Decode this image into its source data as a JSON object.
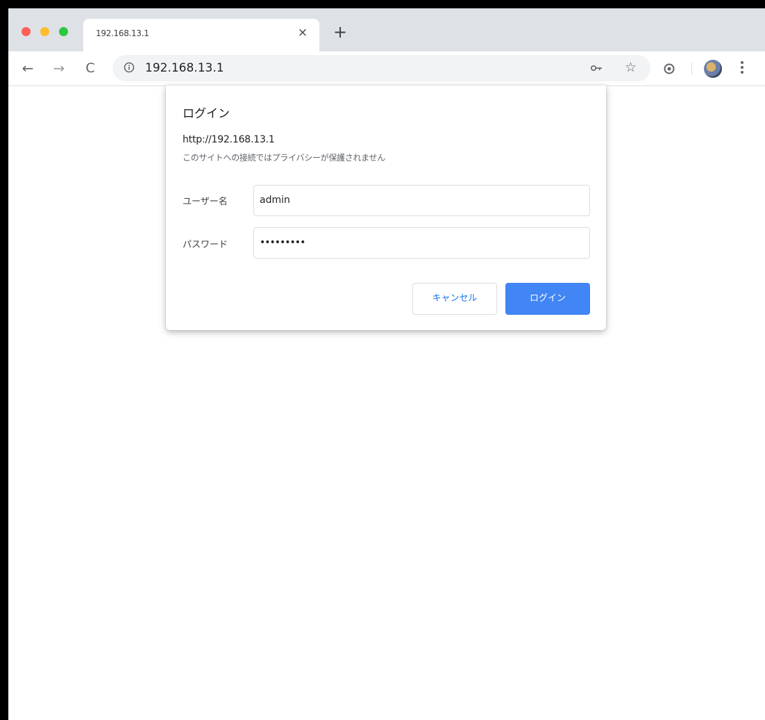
{
  "tab": {
    "title": "192.168.13.1",
    "close_glyph": "×"
  },
  "new_tab_glyph": "+",
  "toolbar": {
    "back_glyph": "←",
    "forward_glyph": "→",
    "reload_glyph": "C",
    "url": "192.168.13.1",
    "star_glyph": "☆"
  },
  "dialog": {
    "title": "ログイン",
    "site_url": "http://192.168.13.1",
    "privacy_warning": "このサイトへの接続ではプライバシーが保護されません",
    "username_label": "ユーザー名",
    "username_value": "admin",
    "password_label": "パスワード",
    "password_value": "•••••••••",
    "cancel_label": "キャンセル",
    "login_label": "ログイン"
  },
  "colors": {
    "accent": "#4285f4",
    "link_blue": "#1a73e8",
    "tabstrip": "#dee1e6"
  },
  "icons": [
    "info-icon",
    "key-icon",
    "star-icon",
    "extension-icon",
    "menu-icon"
  ]
}
